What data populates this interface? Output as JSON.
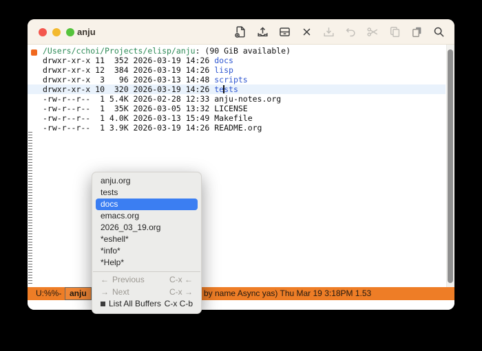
{
  "window": {
    "title": "anju"
  },
  "titlebar": {
    "traffic_lights": [
      "close",
      "minimize",
      "fullscreen"
    ]
  },
  "toolbar": {
    "icons": [
      {
        "name": "new-file-icon",
        "enabled": true
      },
      {
        "name": "open-file-icon",
        "enabled": true
      },
      {
        "name": "dired-folder-icon",
        "enabled": true
      },
      {
        "name": "close-buffer-icon",
        "enabled": true
      },
      {
        "name": "save-icon",
        "enabled": false
      },
      {
        "name": "undo-icon",
        "enabled": false
      },
      {
        "name": "cut-icon",
        "enabled": false
      },
      {
        "name": "copy-icon",
        "enabled": false
      },
      {
        "name": "paste-icon",
        "enabled": false
      },
      {
        "name": "search-icon",
        "enabled": true
      }
    ]
  },
  "buffer": {
    "header_path": "/Users/cchoi/Projects/elisp/anju",
    "header_rest": ": (90 GiB available)",
    "entries": [
      {
        "prefix": "drwxr-xr-x 11  352 2026-03-19 14:26 ",
        "name": "docs"
      },
      {
        "prefix": "drwxr-xr-x 12  384 2026-03-19 14:26 ",
        "name": "lisp"
      },
      {
        "prefix": "drwxr-xr-x  3   96 2026-03-13 14:48 ",
        "name": "scripts"
      },
      {
        "prefix": "drwxr-xr-x 10  320 2026-03-19 14:26 ",
        "name_pre": "te",
        "name_post": "sts"
      },
      {
        "prefix": "-rw-r--r--  1 5.4K 2026-02-28 12:33 ",
        "name": "anju-notes.org"
      },
      {
        "prefix": "-rw-r--r--  1  35K 2026-03-05 13:32 ",
        "name": "LICENSE"
      },
      {
        "prefix": "-rw-r--r--  1 4.0K 2026-03-13 15:49 ",
        "name": "Makefile"
      },
      {
        "prefix": "-rw-r--r--  1 3.9K 2026-03-19 14:26 ",
        "name": "README.org"
      }
    ]
  },
  "menu": {
    "buffers": [
      "anju.org",
      "tests",
      "docs",
      "emacs.org",
      "2026_03_19.org",
      "*eshell*",
      "*info*",
      "*Help*"
    ],
    "selected": "docs",
    "commands": [
      {
        "icon": "←",
        "label": "Previous",
        "shortcut": "C-x ←",
        "enabled": false
      },
      {
        "icon": "→",
        "label": "Next",
        "shortcut": "C-x →",
        "enabled": false
      },
      {
        "icon": "list-icon",
        "label": "List All Buffers",
        "shortcut": "C-x C-b",
        "enabled": true
      }
    ]
  },
  "modeline": {
    "flags": "U:%%-",
    "buffer_name": "anju",
    "right": "by name Async yas) Thu Mar 19 3:18PM 1.53"
  },
  "colors": {
    "modeline_bg": "#ee7d26",
    "selection_blue": "#3b7ef2",
    "dir_blue": "#2d55d0",
    "path_green": "#2e8b57",
    "hl_line": "#e9f2fc",
    "titlebar_bg": "#f8f2e9",
    "bookmark_orange": "#f0681e"
  }
}
